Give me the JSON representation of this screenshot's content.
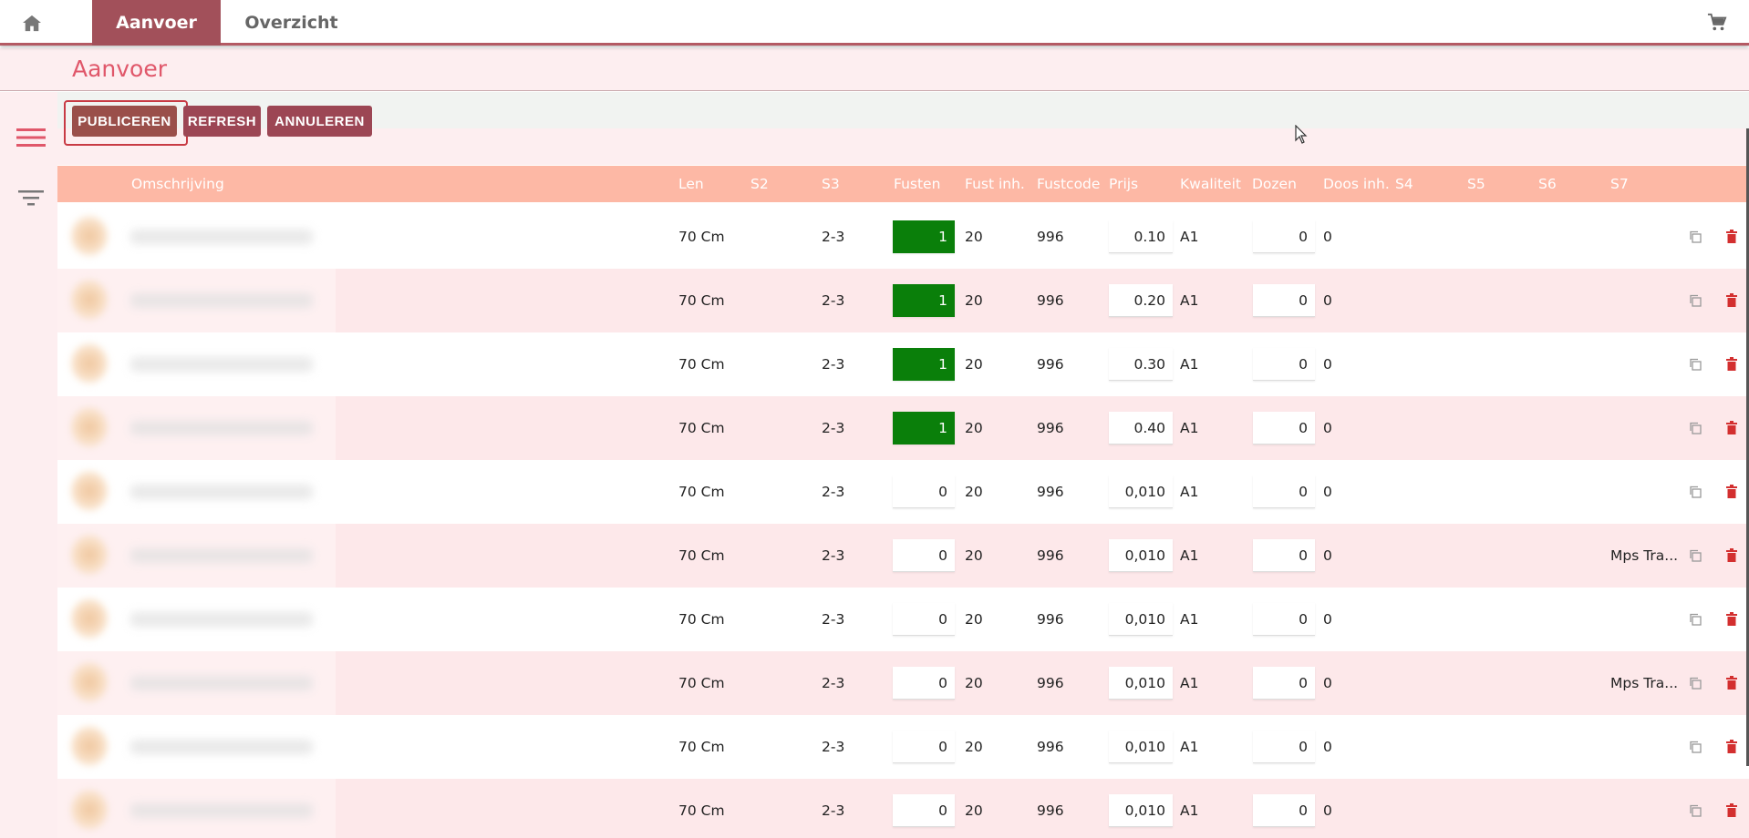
{
  "nav": {
    "home_icon": "home-icon",
    "tabs": [
      {
        "label": "Aanvoer",
        "active": true
      },
      {
        "label": "Overzicht",
        "active": false
      }
    ],
    "cart_icon": "cart-icon"
  },
  "page": {
    "title": "Aanvoer"
  },
  "sidebar": {
    "menu_icon": "hamburger-menu-icon",
    "filter_icon": "filter-icon"
  },
  "toolbar": {
    "publish_label": "PUBLICEREN",
    "refresh_label": "REFRESH",
    "cancel_label": "ANNULEREN"
  },
  "colors": {
    "accent": "#a2505a",
    "header_bg": "#fdb8a5",
    "row_alt": "#fde8ea",
    "title": "#e0576a",
    "fusten_active": "#0a7f0a"
  },
  "table": {
    "columns": [
      "Omschrijving",
      "Len",
      "S2",
      "S3",
      "Fusten",
      "Fust inh.",
      "Fustcode",
      "Prijs",
      "Kwaliteit",
      "Dozen",
      "Doos inh.",
      "S4",
      "S5",
      "S6",
      "S7"
    ],
    "rows": [
      {
        "len": "70 Cm",
        "s2": "",
        "s3": "2-3",
        "fusten": "1",
        "fusten_active": true,
        "fust_inh": "20",
        "fustcode": "996",
        "prijs": "0.10",
        "kwaliteit": "A1",
        "dozen": "0",
        "doos_inh": "0",
        "s4": "",
        "s5": "",
        "s6": "",
        "s7": ""
      },
      {
        "len": "70 Cm",
        "s2": "",
        "s3": "2-3",
        "fusten": "1",
        "fusten_active": true,
        "fust_inh": "20",
        "fustcode": "996",
        "prijs": "0.20",
        "kwaliteit": "A1",
        "dozen": "0",
        "doos_inh": "0",
        "s4": "",
        "s5": "",
        "s6": "",
        "s7": ""
      },
      {
        "len": "70 Cm",
        "s2": "",
        "s3": "2-3",
        "fusten": "1",
        "fusten_active": true,
        "fust_inh": "20",
        "fustcode": "996",
        "prijs": "0.30",
        "kwaliteit": "A1",
        "dozen": "0",
        "doos_inh": "0",
        "s4": "",
        "s5": "",
        "s6": "",
        "s7": ""
      },
      {
        "len": "70 Cm",
        "s2": "",
        "s3": "2-3",
        "fusten": "1",
        "fusten_active": true,
        "fust_inh": "20",
        "fustcode": "996",
        "prijs": "0.40",
        "kwaliteit": "A1",
        "dozen": "0",
        "doos_inh": "0",
        "s4": "",
        "s5": "",
        "s6": "",
        "s7": ""
      },
      {
        "len": "70 Cm",
        "s2": "",
        "s3": "2-3",
        "fusten": "0",
        "fusten_active": false,
        "fust_inh": "20",
        "fustcode": "996",
        "prijs": "0,010",
        "kwaliteit": "A1",
        "dozen": "0",
        "doos_inh": "0",
        "s4": "",
        "s5": "",
        "s6": "",
        "s7": ""
      },
      {
        "len": "70 Cm",
        "s2": "",
        "s3": "2-3",
        "fusten": "0",
        "fusten_active": false,
        "fust_inh": "20",
        "fustcode": "996",
        "prijs": "0,010",
        "kwaliteit": "A1",
        "dozen": "0",
        "doos_inh": "0",
        "s4": "",
        "s5": "",
        "s6": "",
        "s7": "Mps Tra..."
      },
      {
        "len": "70 Cm",
        "s2": "",
        "s3": "2-3",
        "fusten": "0",
        "fusten_active": false,
        "fust_inh": "20",
        "fustcode": "996",
        "prijs": "0,010",
        "kwaliteit": "A1",
        "dozen": "0",
        "doos_inh": "0",
        "s4": "",
        "s5": "",
        "s6": "",
        "s7": ""
      },
      {
        "len": "70 Cm",
        "s2": "",
        "s3": "2-3",
        "fusten": "0",
        "fusten_active": false,
        "fust_inh": "20",
        "fustcode": "996",
        "prijs": "0,010",
        "kwaliteit": "A1",
        "dozen": "0",
        "doos_inh": "0",
        "s4": "",
        "s5": "",
        "s6": "",
        "s7": "Mps Tra..."
      },
      {
        "len": "70 Cm",
        "s2": "",
        "s3": "2-3",
        "fusten": "0",
        "fusten_active": false,
        "fust_inh": "20",
        "fustcode": "996",
        "prijs": "0,010",
        "kwaliteit": "A1",
        "dozen": "0",
        "doos_inh": "0",
        "s4": "",
        "s5": "",
        "s6": "",
        "s7": ""
      },
      {
        "len": "70 Cm",
        "s2": "",
        "s3": "2-3",
        "fusten": "0",
        "fusten_active": false,
        "fust_inh": "20",
        "fustcode": "996",
        "prijs": "0,010",
        "kwaliteit": "A1",
        "dozen": "0",
        "doos_inh": "0",
        "s4": "",
        "s5": "",
        "s6": "",
        "s7": ""
      }
    ],
    "row_icons": {
      "copy": "copy-icon",
      "delete": "trash-icon"
    }
  }
}
